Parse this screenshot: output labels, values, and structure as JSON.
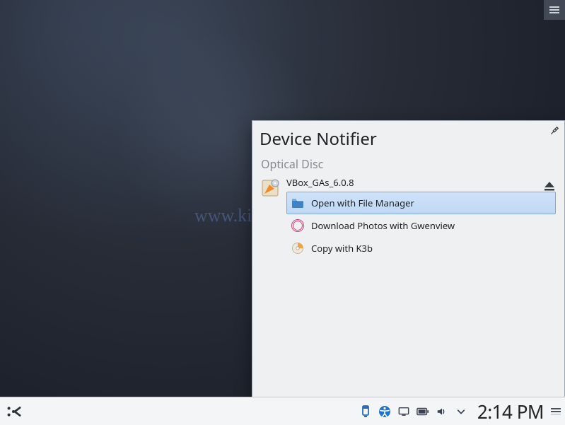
{
  "top_handle": {
    "name": "panel-handle"
  },
  "watermark": "www.kifarunix.com",
  "notifier": {
    "title": "Device Notifier",
    "pin_icon": "pin-icon",
    "section_label": "Optical Disc",
    "device": {
      "icon": "optical-disc-icon",
      "name": "VBox_GAs_6.0.8",
      "eject_icon": "eject-icon"
    },
    "actions": [
      {
        "icon": "folder-icon",
        "label": "Open with File Manager",
        "selected": true
      },
      {
        "icon": "gwenview-icon",
        "label": "Download Photos with Gwenview",
        "selected": false
      },
      {
        "icon": "k3b-icon",
        "label": "Copy with K3b",
        "selected": false
      }
    ]
  },
  "panel": {
    "launcher_icon": "kde-launcher-icon",
    "tray": [
      {
        "name": "device-notifier-tray-icon"
      },
      {
        "name": "accessibility-icon"
      },
      {
        "name": "display-icon"
      },
      {
        "name": "battery-icon"
      },
      {
        "name": "volume-icon"
      }
    ],
    "tray_expand_icon": "chevron-down-icon",
    "clock": "2:14 PM",
    "menu_icon": "hamburger-icon"
  }
}
